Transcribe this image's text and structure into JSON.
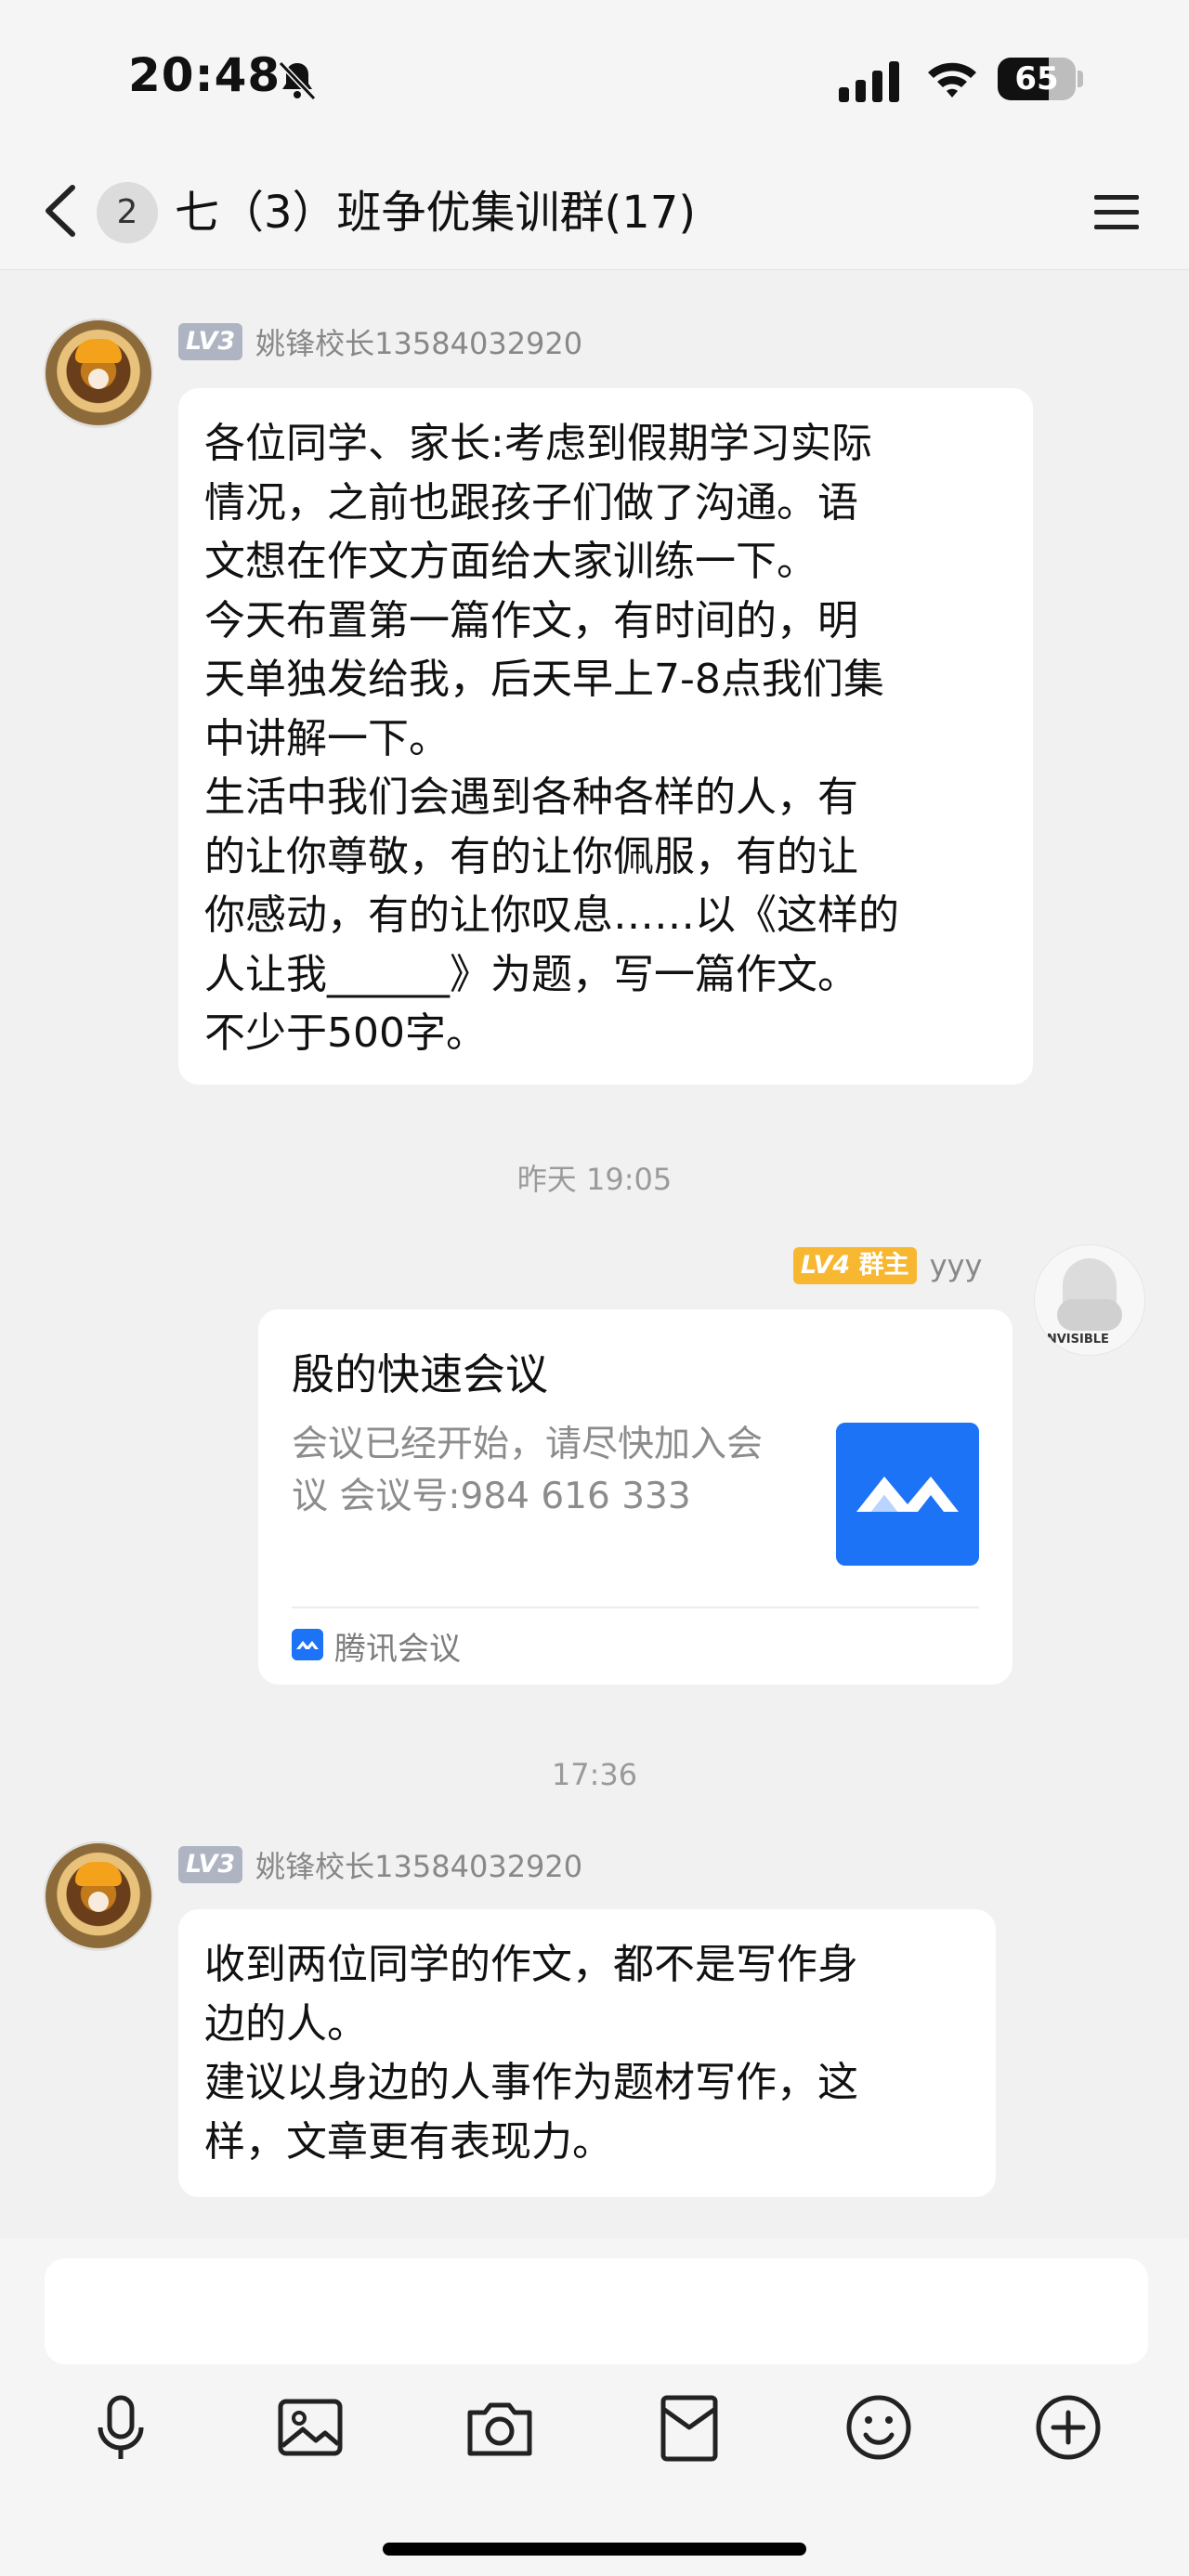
{
  "status": {
    "time": "20:48",
    "battery_level": "65",
    "battery_fraction": 0.65,
    "icons": [
      "bell-slash-icon",
      "signal-icon",
      "wifi-icon",
      "battery-icon"
    ]
  },
  "header": {
    "back_icon": "chevron-left-icon",
    "unread_count": "2",
    "title": "七（3）班争优集训群(17)",
    "menu_icon": "hamburger-menu-icon"
  },
  "messages": [
    {
      "level": "LV3",
      "sender": "姚锋校长13584032920",
      "text": "各位同学、家长:考虑到假期学习实际\n情况，之前也跟孩子们做了沟通。语\n文想在作文方面给大家训练一下。\n今天布置第一篇作文，有时间的，明\n天单独发给我，后天早上7-8点我们集\n中讲解一下。\n生活中我们会遇到各种各样的人，有\n的让你尊敬，有的让你佩服，有的让\n你感动，有的让你叹息……以《这样的\n人让我______》为题，写一篇作文。\n不少于500字。"
    },
    {
      "level": "LV3",
      "sender": "姚锋校长13584032920",
      "text": "收到两位同学的作文，都不是写作身\n边的人。\n建议以身边的人事作为题材写作，这\n样，文章更有表现力。"
    }
  ],
  "time_dividers": [
    "昨天 19:05",
    "17:36"
  ],
  "owner_message": {
    "level": "LV4",
    "role": "群主",
    "sender": "yyy",
    "avatar_caption": "INVISIBLE",
    "card": {
      "title": "殷的快速会议",
      "description": "会议已经开始，请尽快加入会议 会议号:984 616 333",
      "app_name": "腾讯会议",
      "brand_color": "#1c73f6"
    }
  },
  "input": {
    "placeholder": ""
  },
  "toolbar": {
    "icons": [
      "microphone-icon",
      "image-icon",
      "camera-icon",
      "red-packet-icon",
      "emoji-icon",
      "plus-circle-icon"
    ]
  },
  "colors": {
    "background": "#f1f1f1",
    "bubble": "#ffffff",
    "level_gray": "#aeb4c2",
    "level_gold": "#f7b731",
    "muted_text": "#888888"
  }
}
